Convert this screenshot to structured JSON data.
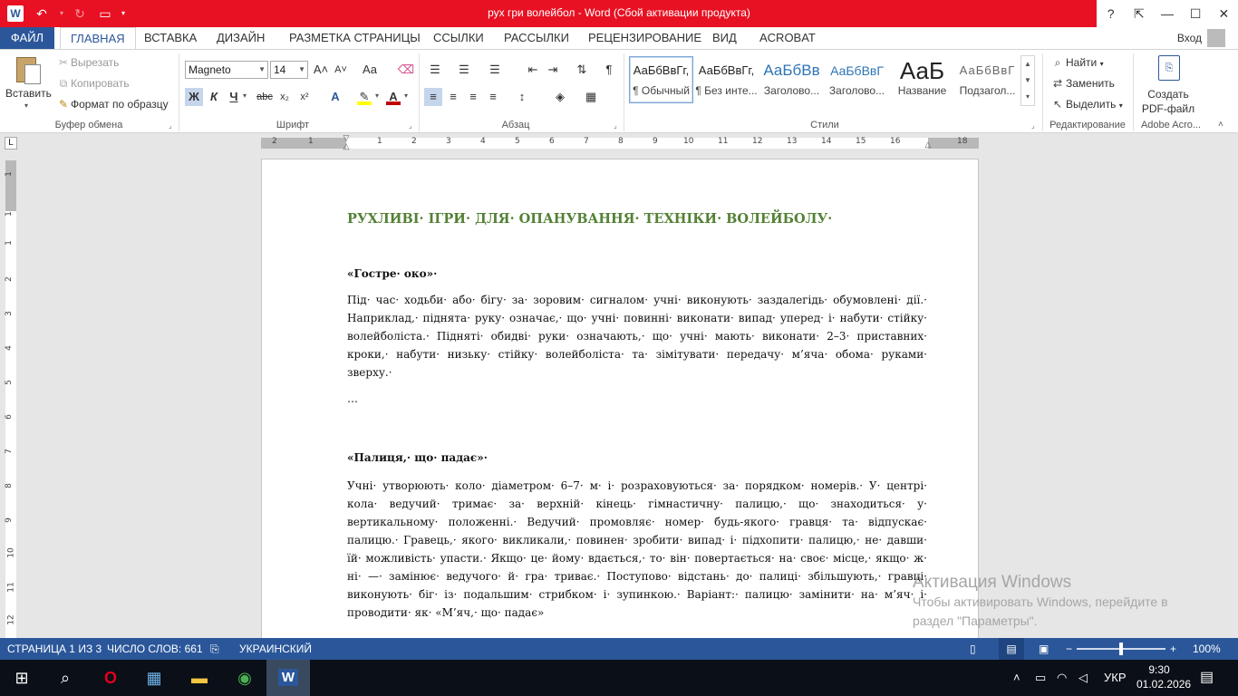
{
  "titlebar": {
    "app_icon": "word-icon",
    "title": "рух гри волейбол -  Word (Сбой активации продукта)",
    "help": "?",
    "ribbon_display": "⇱",
    "minimize": "—",
    "maximize": "☐",
    "close": "✕"
  },
  "tabs": {
    "file": "ФАЙЛ",
    "items": [
      "ГЛАВНАЯ",
      "ВСТАВКА",
      "ДИЗАЙН",
      "РАЗМЕТКА СТРАНИЦЫ",
      "ССЫЛКИ",
      "РАССЫЛКИ",
      "РЕЦЕНЗИРОВАНИЕ",
      "ВИД",
      "ACROBAT"
    ],
    "active": "ГЛАВНАЯ",
    "signin": "Вход"
  },
  "ribbon": {
    "clipboard": {
      "paste": "Вставить",
      "cut": "Вырезать",
      "copy": "Копировать",
      "format_painter": "Формат по образцу",
      "label": "Буфер обмена"
    },
    "font": {
      "name": "Magneto",
      "size": "14",
      "label": "Шрифт",
      "bold": "Ж",
      "italic": "К",
      "underline": "Ч",
      "strike": "abc",
      "sub": "x₂",
      "sup": "x²",
      "grow": "A˄",
      "shrink": "A˅",
      "case": "Aa",
      "highlight_color": "#ffff00",
      "font_color": "#c00000"
    },
    "paragraph": {
      "label": "Абзац"
    },
    "styles": {
      "label": "Стили",
      "items": [
        {
          "preview": "АаБбВвГг,",
          "name": "¶ Обычный"
        },
        {
          "preview": "АаБбВвГг,",
          "name": "¶ Без инте..."
        },
        {
          "preview": "АаБбВв",
          "name": "Заголово..."
        },
        {
          "preview": "АаБбВвГ",
          "name": "Заголово..."
        },
        {
          "preview": "АаБ",
          "name": "Название"
        },
        {
          "preview": "АаБбВвГ",
          "name": "Подзагол..."
        }
      ]
    },
    "editing": {
      "label": "Редактирование",
      "find": "Найти",
      "replace": "Заменить",
      "select": "Выделить"
    },
    "acrobat": {
      "label": "Adobe Acro...",
      "create_pdf_line1": "Создать",
      "create_pdf_line2": "PDF-файл"
    }
  },
  "ruler": {
    "numbers": [
      "2",
      "1",
      "1",
      "2",
      "3",
      "4",
      "5",
      "6",
      "7",
      "8",
      "9",
      "10",
      "11",
      "12",
      "13",
      "14",
      "15",
      "16",
      "18"
    ],
    "vertical_numbers": [
      "1",
      "1",
      "1",
      "2",
      "3",
      "4",
      "5",
      "6",
      "7",
      "8",
      "9",
      "10",
      "11",
      "12"
    ],
    "tab_selector": "L"
  },
  "document": {
    "heading": "РУХЛИВІ· ІГРИ· ДЛЯ· ОПАНУВАННЯ· ТЕХНІКИ· ВОЛЕЙБОЛУ·",
    "section1_title": "«Гостре· око»·",
    "section1_text": "Під· час· ходьби· або· бігу· за· зоровим· сигналом· учні· виконують· заздалегідь· обумовлені· дії.· Наприклад,· піднята· руку· означає,· що· учні· повинні· виконати· випад· уперед· і· набути· стійку· волейболіста.· Підняті· обидві· руки· означають,· що· учні· мають· виконати· 2–3· приставних· кроки,· набути· низьку· стійку· волейболіста· та· зімітувати· передачу· м’яча· обома· руками· зверху.·",
    "ellipsis1": "…",
    "section2_title": "«Палиця,· що· падає»·",
    "section2_text": "Учні· утворюють· коло· діаметром· 6–7· м· і· розраховуються· за· порядком· номерів.· У· центрі· кола· ведучий· тримає· за· верхній· кінець· гімнастичну· палицю,· що· знаходиться· у· вертикальному· положенні.· Ведучий· промовляє· номер· будь-якого· гравця· та· відпускає· палицю.· Гравець,· якого· викликали,· повинен· зробити· випад· і· підхопити· палицю,· не· давши· їй· можливість· упасти.· Якщо· це· йому· вдається,· то· він· повертається· на· своє· місце,· якщо· ж· ні· —· замінює· ведучого· й· гра· триває.· Поступово· відстань· до· палиці· збільшують,· гравці· виконують· біг· із· подальшим· стрибком· і· зупинкою.· Варіант:· палицю· замінити· на· м’яч· і· проводити· як· «М’яч,· що· падає»",
    "ellipsis2": "…"
  },
  "watermark": {
    "title": "Активация Windows",
    "line1": "Чтобы активировать Windows, перейдите в",
    "line2": "раздел \"Параметры\"."
  },
  "statusbar": {
    "page": "СТРАНИЦА 1 ИЗ 3",
    "words": "ЧИСЛО СЛОВ: 661",
    "language": "УКРАИНСКИЙ",
    "zoom": "100%",
    "zoom_level": 0.5
  },
  "taskbar": {
    "language": "УКР",
    "time": "9:30",
    "date": "01.02.2026"
  }
}
